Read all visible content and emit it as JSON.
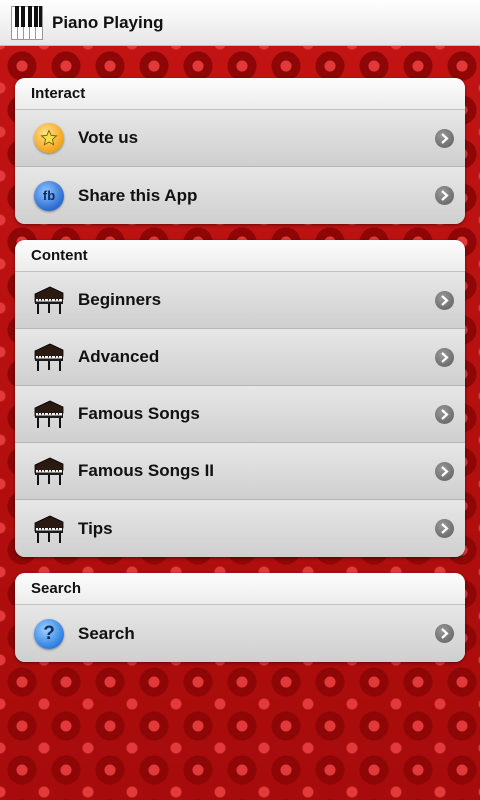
{
  "app": {
    "title": "Piano Playing"
  },
  "sections": [
    {
      "header": "Interact",
      "items": [
        {
          "label": "Vote us",
          "icon": "star-icon"
        },
        {
          "label": "Share this App",
          "icon": "facebook-icon"
        }
      ]
    },
    {
      "header": "Content",
      "items": [
        {
          "label": "Beginners",
          "icon": "grand-piano-icon"
        },
        {
          "label": "Advanced",
          "icon": "grand-piano-icon"
        },
        {
          "label": "Famous Songs",
          "icon": "grand-piano-icon"
        },
        {
          "label": "Famous Songs II",
          "icon": "grand-piano-icon"
        },
        {
          "label": "Tips",
          "icon": "grand-piano-icon"
        }
      ]
    },
    {
      "header": "Search",
      "items": [
        {
          "label": "Search",
          "icon": "help-question-icon"
        }
      ]
    }
  ],
  "colors": {
    "background": "#b30d0d",
    "row_gradient_top": "#e7e7e7",
    "row_gradient_bottom": "#cfcfcf"
  }
}
